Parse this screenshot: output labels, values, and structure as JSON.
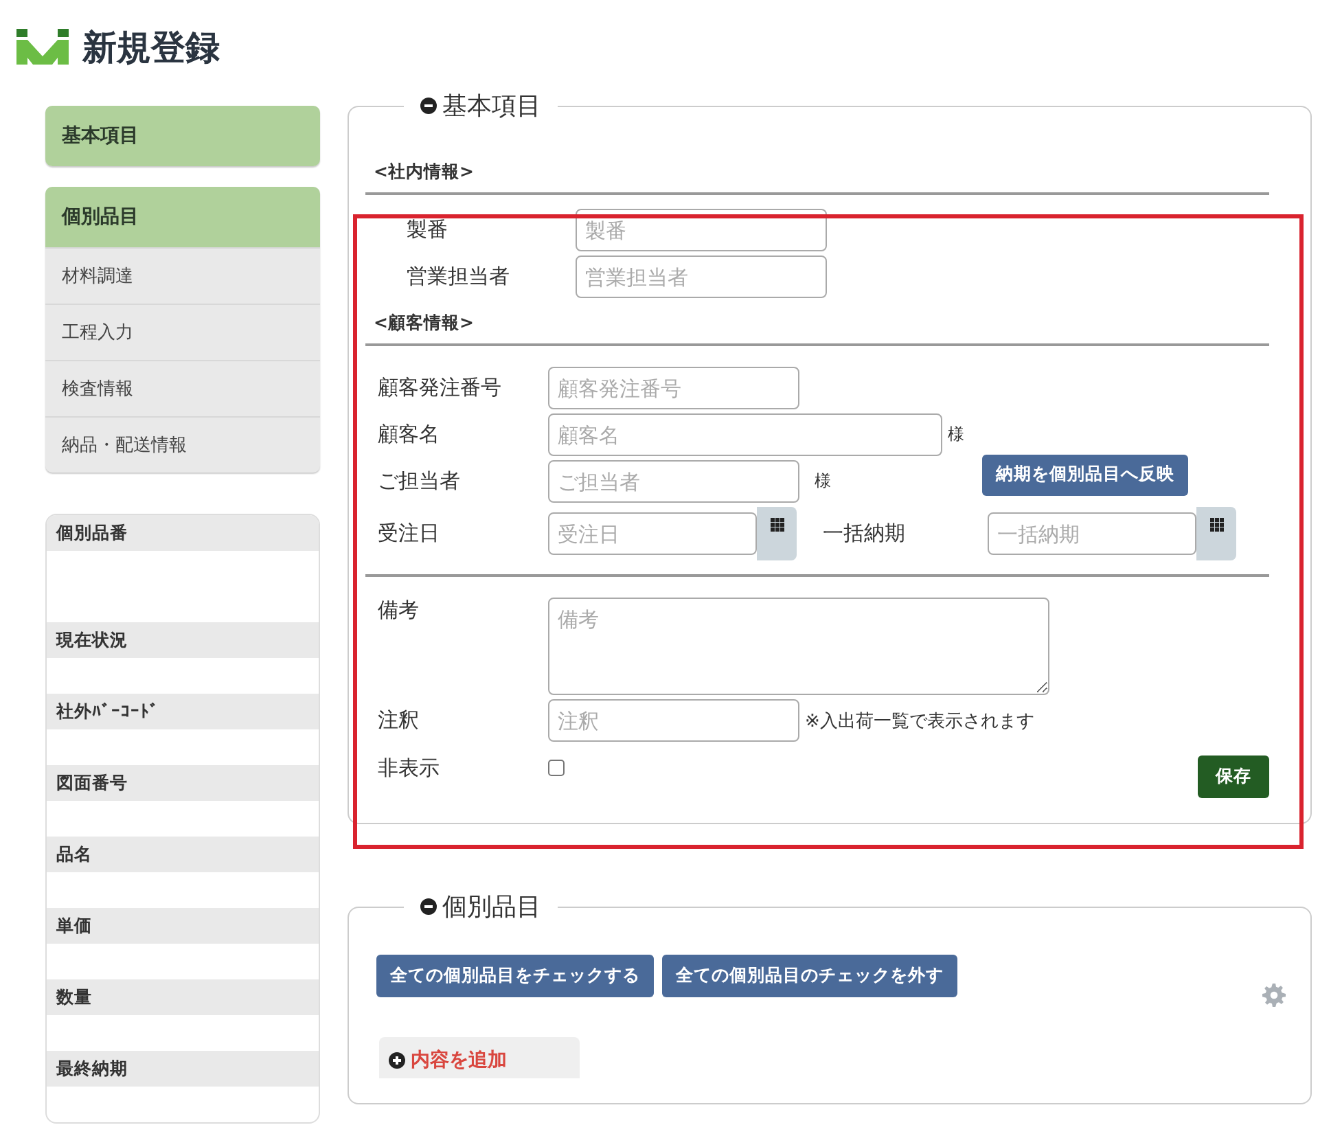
{
  "page": {
    "title": "新規登録"
  },
  "sidebar": {
    "sections": [
      {
        "label": "基本項目"
      },
      {
        "label": "個別品目",
        "items": [
          "材料調達",
          "工程入力",
          "検査情報",
          "納品・配送情報"
        ]
      }
    ]
  },
  "summary": [
    "個別品番",
    "現在状況",
    "社外ﾊﾞｰｺｰﾄﾞ",
    "図面番号",
    "品名",
    "単価",
    "数量",
    "最終納期"
  ],
  "basic": {
    "legend": "基本項目",
    "internal": {
      "heading": "<社内情報>",
      "fields": [
        {
          "label": "製番",
          "placeholder": "製番"
        },
        {
          "label": "営業担当者",
          "placeholder": "営業担当者"
        }
      ]
    },
    "customer": {
      "heading": "<顧客情報>",
      "order_number": {
        "label": "顧客発注番号",
        "placeholder": "顧客発注番号"
      },
      "customer_name": {
        "label": "顧客名",
        "placeholder": "顧客名",
        "suffix": "様"
      },
      "contact": {
        "label": "ご担当者",
        "placeholder": "ご担当者",
        "suffix": "様"
      },
      "apply_button": "納期を個別品目へ反映",
      "order_date": {
        "label": "受注日",
        "placeholder": "受注日"
      },
      "due_date": {
        "label": "一括納期",
        "placeholder": "一括納期"
      }
    },
    "remarks": {
      "label": "備考",
      "placeholder": "備考"
    },
    "note": {
      "label": "注釈",
      "placeholder": "注釈",
      "hint": "※入出荷一覧で表示されます"
    },
    "hidden": {
      "label": "非表示",
      "checked": false
    },
    "save_button": "保存"
  },
  "items": {
    "legend": "個別品目",
    "buttons": [
      "全ての個別品目をチェックする",
      "全ての個別品目のチェックを外す"
    ],
    "add_label": "内容を追加"
  }
}
